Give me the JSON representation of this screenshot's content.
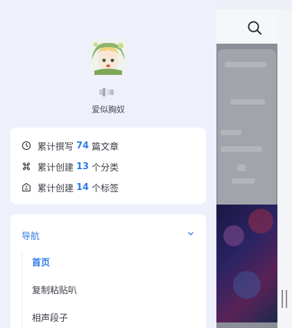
{
  "profile": {
    "username": "爱似胸奴"
  },
  "stats": [
    {
      "prefix": "累计撰写",
      "count": "74",
      "suffix": "篇文章",
      "icon": "clock-icon"
    },
    {
      "prefix": "累计创建",
      "count": "13",
      "suffix": "个分类",
      "icon": "command-icon"
    },
    {
      "prefix": "累计创建",
      "count": "14",
      "suffix": "个标签",
      "icon": "tag-icon"
    }
  ],
  "nav": {
    "title": "导航",
    "expanded": true,
    "items": [
      {
        "label": "首页",
        "active": true
      },
      {
        "label": "复制粘贴叭",
        "active": false
      },
      {
        "label": "相声段子",
        "active": false
      }
    ]
  },
  "colors": {
    "accent": "#2f7be7",
    "drawer_bg": "#eef1fb",
    "card_bg": "#ffffff"
  }
}
